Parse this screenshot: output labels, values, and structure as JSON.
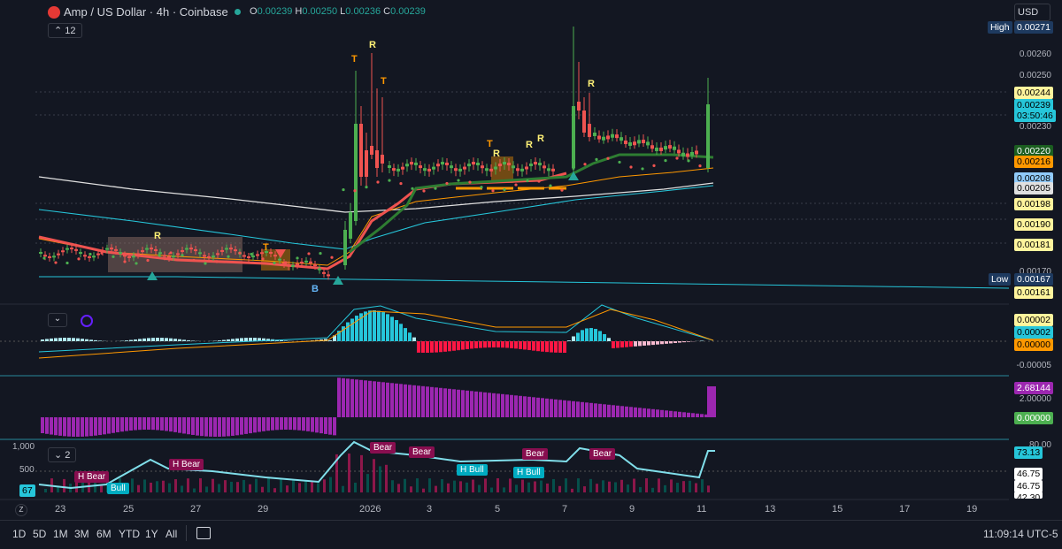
{
  "header": {
    "symbol_title": "Amp / US Dollar · 4h · Coinbase",
    "o_label": "O",
    "o_value": "0.00239",
    "h_label": "H",
    "h_value": "0.00250",
    "l_label": "L",
    "l_value": "0.00236",
    "c_label": "C",
    "c_value": "0.00239",
    "indicator_count": "12",
    "currency": "USD"
  },
  "price_axis": {
    "high_label": "High",
    "high_value": "0.00271",
    "ticks": [
      "0.00260",
      "0.00250",
      "0.00230",
      "0.00170"
    ],
    "badges": [
      {
        "value": "0.00244",
        "color": "#fff59d",
        "text_color": "#000"
      },
      {
        "value": "0.00239",
        "color": "#26c6da",
        "text_color": "#000"
      },
      {
        "value": "03:50:46",
        "color": "#26c6da",
        "text_color": "#000"
      },
      {
        "value": "0.00220",
        "color": "#1b5e20",
        "text_color": "#fff"
      },
      {
        "value": "0.00216",
        "color": "#ff9800",
        "text_color": "#000"
      },
      {
        "value": "0.00208",
        "color": "#90caf9",
        "text_color": "#000"
      },
      {
        "value": "0.00205",
        "color": "#e0e0e0",
        "text_color": "#000"
      },
      {
        "value": "0.00198",
        "color": "#fff59d",
        "text_color": "#000"
      },
      {
        "value": "0.00190",
        "color": "#fff59d",
        "text_color": "#000"
      },
      {
        "value": "0.00181",
        "color": "#fff59d",
        "text_color": "#000"
      }
    ],
    "low_label": "Low",
    "low_value": "0.00167",
    "last_value": "0.00161"
  },
  "chart_markers": {
    "t": "T",
    "r": "R",
    "b": "B"
  },
  "macd_pane": {
    "axis": [
      "0.00002",
      "0.00002",
      "0.00000",
      "-0.00005"
    ],
    "badge_colors": [
      "#fff59d",
      "#26c6da",
      "#26c6da",
      "#ff9800"
    ]
  },
  "hist_pane": {
    "value": "2.68144",
    "tick": "2.00000",
    "zero": "0.00000"
  },
  "osc_pane": {
    "indicator_count": "2",
    "left_ticks": [
      "1,000",
      "500"
    ],
    "left_badge": "67",
    "axis_top": "80.00",
    "value": "73.13",
    "axis_vals": [
      "46.75",
      "46.75",
      "42.30"
    ],
    "signals": [
      {
        "text": "H Bear",
        "type": "bear"
      },
      {
        "text": "Bull",
        "type": "bull"
      },
      {
        "text": "H Bear",
        "type": "bear"
      },
      {
        "text": "Bear",
        "type": "bear"
      },
      {
        "text": "Bear",
        "type": "bear"
      },
      {
        "text": "H Bull",
        "type": "bull"
      },
      {
        "text": "Bear",
        "type": "bear"
      },
      {
        "text": "H Bull",
        "type": "bull"
      },
      {
        "text": "Bear",
        "type": "bear"
      }
    ]
  },
  "time_axis": [
    "23",
    "25",
    "27",
    "29",
    "2026",
    "3",
    "5",
    "7",
    "9",
    "11",
    "13",
    "15",
    "17",
    "19"
  ],
  "bottom_toolbar": {
    "ranges": [
      "1D",
      "5D",
      "1M",
      "3M",
      "6M",
      "YTD",
      "1Y",
      "All"
    ],
    "clock": "11:09:14 UTC-5"
  },
  "colors": {
    "background": "#131722",
    "up": "#26a69a",
    "green": "#4caf50",
    "down": "#ef5350",
    "cyan": "#26c6da",
    "purple": "#9c27b0",
    "orange": "#ff9800",
    "yellow": "#fff176"
  }
}
